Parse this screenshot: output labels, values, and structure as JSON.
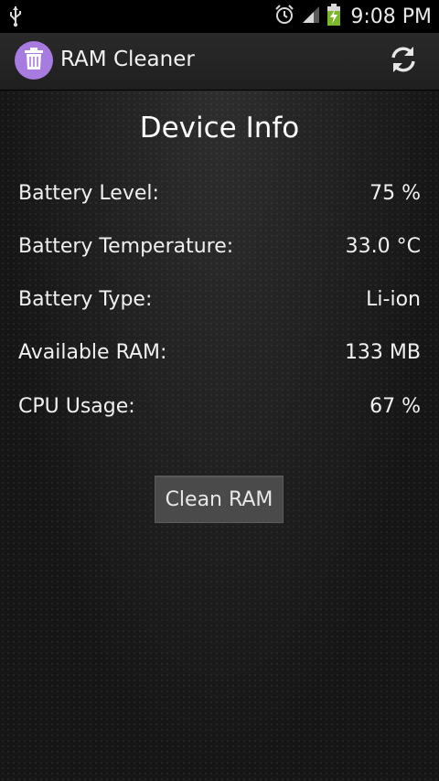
{
  "status_bar": {
    "time": "9:08 PM",
    "icons": [
      "usb-icon",
      "alarm-clock-icon",
      "signal-icon",
      "battery-charging-icon"
    ]
  },
  "action_bar": {
    "title": "RAM Cleaner",
    "app_icon": "trash-can-icon",
    "refresh_icon": "refresh-icon",
    "accent_color": "#a77be0"
  },
  "device_info": {
    "title": "Device Info",
    "rows": [
      {
        "label": "Battery Level:",
        "value": "75 %"
      },
      {
        "label": "Battery Temperature:",
        "value": "33.0 °C"
      },
      {
        "label": "Battery Type:",
        "value": "Li-ion"
      },
      {
        "label": "Available RAM:",
        "value": "133 MB"
      },
      {
        "label": "CPU Usage:",
        "value": "67 %"
      }
    ]
  },
  "actions": {
    "clean_label": "Clean RAM"
  }
}
